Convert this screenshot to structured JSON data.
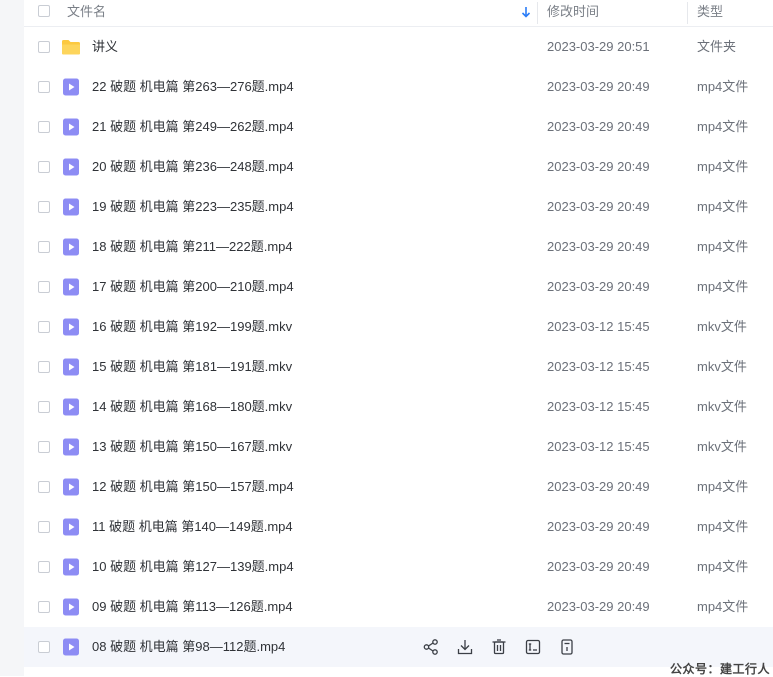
{
  "header": {
    "name_label": "文件名",
    "time_label": "修改时间",
    "type_label": "类型"
  },
  "colors": {
    "folder": "#fcc941",
    "video_icon": "#8d8cf4",
    "hover_row": "#f4f6fb",
    "sort_arrow": "#2a7cf7"
  },
  "files": [
    {
      "name": "讲义",
      "time": "2023-03-29 20:51",
      "type": "文件夹",
      "icon": "folder-icon"
    },
    {
      "name": "22 破题 机电篇 第263—276题.mp4",
      "time": "2023-03-29 20:49",
      "type": "mp4文件",
      "icon": "video-file-icon"
    },
    {
      "name": "21 破题 机电篇 第249—262题.mp4",
      "time": "2023-03-29 20:49",
      "type": "mp4文件",
      "icon": "video-file-icon"
    },
    {
      "name": "20 破题 机电篇 第236—248题.mp4",
      "time": "2023-03-29 20:49",
      "type": "mp4文件",
      "icon": "video-file-icon"
    },
    {
      "name": "19 破题 机电篇 第223—235题.mp4",
      "time": "2023-03-29 20:49",
      "type": "mp4文件",
      "icon": "video-file-icon"
    },
    {
      "name": "18 破题 机电篇 第211—222题.mp4",
      "time": "2023-03-29 20:49",
      "type": "mp4文件",
      "icon": "video-file-icon"
    },
    {
      "name": "17 破题 机电篇 第200—210题.mp4",
      "time": "2023-03-29 20:49",
      "type": "mp4文件",
      "icon": "video-file-icon"
    },
    {
      "name": "16 破题 机电篇 第192—199题.mkv",
      "time": "2023-03-12 15:45",
      "type": "mkv文件",
      "icon": "video-file-icon"
    },
    {
      "name": "15 破题 机电篇 第181—191题.mkv",
      "time": "2023-03-12 15:45",
      "type": "mkv文件",
      "icon": "video-file-icon"
    },
    {
      "name": "14 破题 机电篇 第168—180题.mkv",
      "time": "2023-03-12 15:45",
      "type": "mkv文件",
      "icon": "video-file-icon"
    },
    {
      "name": "13 破题 机电篇 第150—167题.mkv",
      "time": "2023-03-12 15:45",
      "type": "mkv文件",
      "icon": "video-file-icon"
    },
    {
      "name": "12 破题 机电篇 第150—157题.mp4",
      "time": "2023-03-29 20:49",
      "type": "mp4文件",
      "icon": "video-file-icon"
    },
    {
      "name": "11 破题 机电篇 第140—149题.mp4",
      "time": "2023-03-29 20:49",
      "type": "mp4文件",
      "icon": "video-file-icon"
    },
    {
      "name": "10 破题 机电篇 第127—139题.mp4",
      "time": "2023-03-29 20:49",
      "type": "mp4文件",
      "icon": "video-file-icon"
    },
    {
      "name": "09 破题 机电篇 第113—126题.mp4",
      "time": "2023-03-29 20:49",
      "type": "mp4文件",
      "icon": "video-file-icon"
    },
    {
      "name": "08 破题 机电篇 第98—112题.mp4",
      "time": "",
      "type": "",
      "icon": "video-file-icon",
      "hovered": true
    }
  ],
  "row_actions": [
    {
      "name": "share-icon"
    },
    {
      "name": "download-icon"
    },
    {
      "name": "delete-icon"
    },
    {
      "name": "rename-icon"
    },
    {
      "name": "more-icon"
    }
  ],
  "watermark": "公众号：建工行人"
}
